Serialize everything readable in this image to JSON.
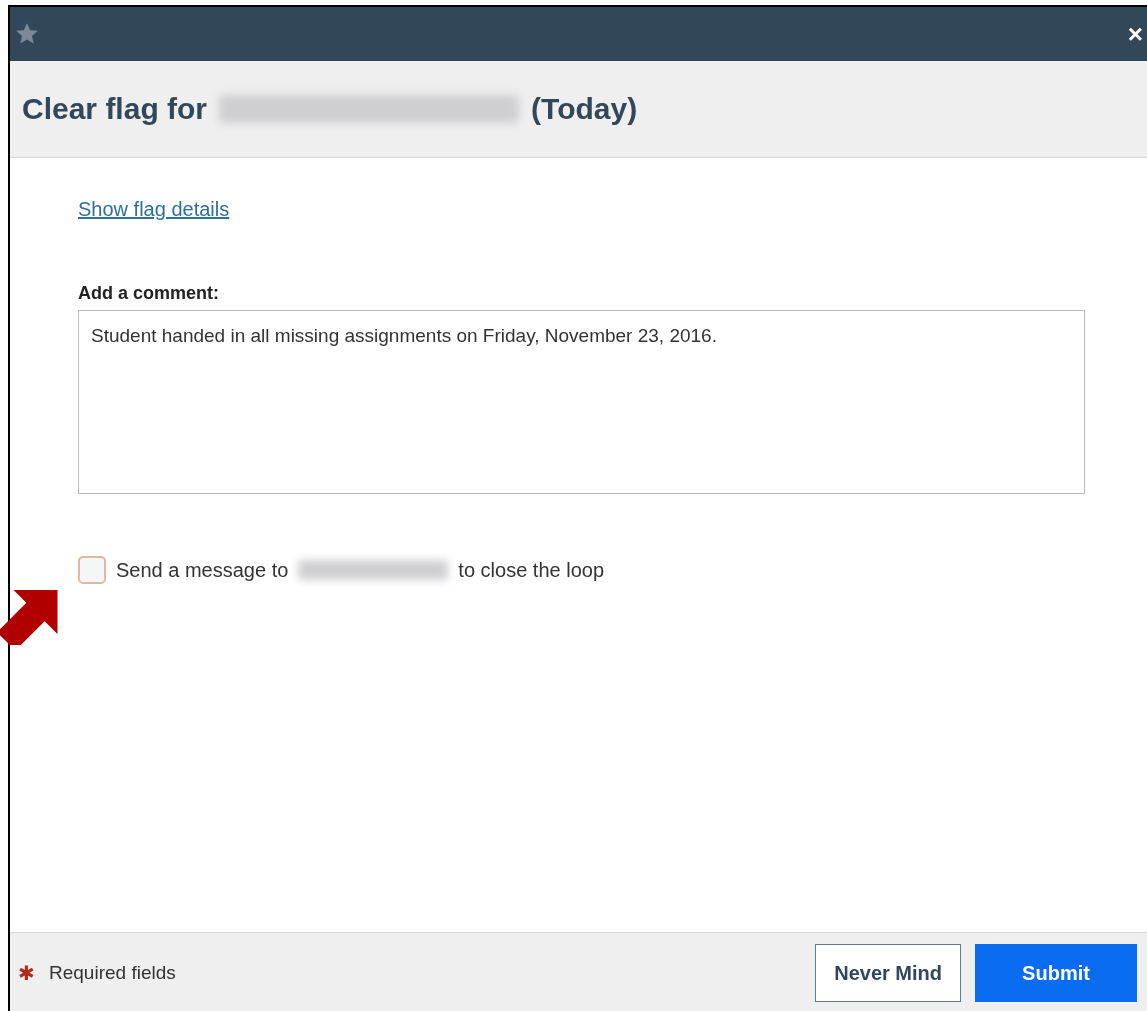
{
  "dialog": {
    "close_glyph": "×",
    "title_before": "Clear flag for",
    "title_after": "(Today)"
  },
  "link": "Show flag details",
  "comment": {
    "label": "Add a comment:",
    "value": "Student handed in all missing assignments on Friday, November 23, 2016."
  },
  "message_option": {
    "checked": false,
    "label_before": "Send a message to",
    "label_after": "to close the loop"
  },
  "footer": {
    "required_mark": "✱",
    "required_text": "Required fields",
    "buttons": [
      {
        "label": "Never Mind",
        "kind": "secondary"
      },
      {
        "label": "Submit",
        "kind": "primary"
      }
    ]
  }
}
